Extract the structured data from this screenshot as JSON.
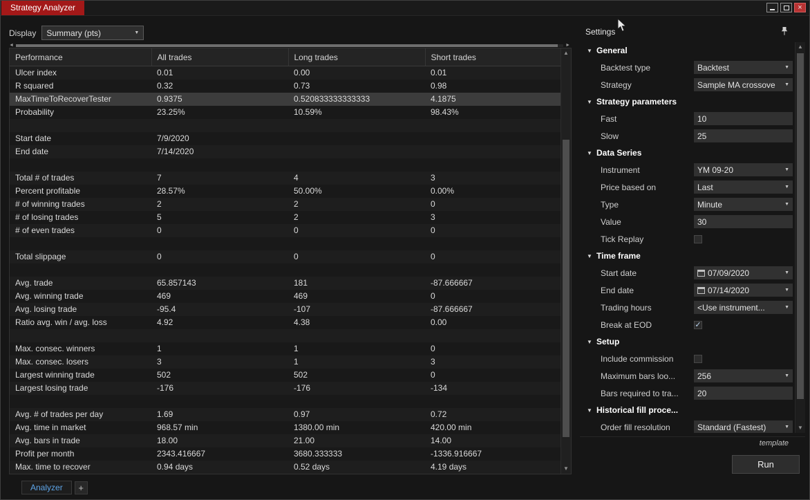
{
  "window": {
    "title": "Strategy Analyzer"
  },
  "toolbar": {
    "display_label": "Display",
    "display_value": "Summary (pts)"
  },
  "table": {
    "columns": [
      "Performance",
      "All trades",
      "Long trades",
      "Short trades"
    ],
    "selected_row": 2,
    "rows": [
      [
        "Ulcer index",
        "0.01",
        "0.00",
        "0.01"
      ],
      [
        "R squared",
        "0.32",
        "0.73",
        "0.98"
      ],
      [
        "MaxTimeToRecoverTester",
        "0.9375",
        "0.520833333333333",
        "4.1875"
      ],
      [
        "Probability",
        "23.25%",
        "10.59%",
        "98.43%"
      ],
      [
        "",
        "",
        "",
        ""
      ],
      [
        "Start date",
        "7/9/2020",
        "",
        ""
      ],
      [
        "End date",
        "7/14/2020",
        "",
        ""
      ],
      [
        "",
        "",
        "",
        ""
      ],
      [
        "Total # of trades",
        "7",
        "4",
        "3"
      ],
      [
        "Percent profitable",
        "28.57%",
        "50.00%",
        "0.00%"
      ],
      [
        "# of winning trades",
        "2",
        "2",
        "0"
      ],
      [
        "# of losing trades",
        "5",
        "2",
        "3"
      ],
      [
        "# of even trades",
        "0",
        "0",
        "0"
      ],
      [
        "",
        "",
        "",
        ""
      ],
      [
        "Total slippage",
        "0",
        "0",
        "0"
      ],
      [
        "",
        "",
        "",
        ""
      ],
      [
        "Avg. trade",
        "65.857143",
        "181",
        "-87.666667"
      ],
      [
        "Avg. winning trade",
        "469",
        "469",
        "0"
      ],
      [
        "Avg. losing trade",
        "-95.4",
        "-107",
        "-87.666667"
      ],
      [
        "Ratio avg. win / avg. loss",
        "4.92",
        "4.38",
        "0.00"
      ],
      [
        "",
        "",
        "",
        ""
      ],
      [
        "Max. consec. winners",
        "1",
        "1",
        "0"
      ],
      [
        "Max. consec. losers",
        "3",
        "1",
        "3"
      ],
      [
        "Largest winning trade",
        "502",
        "502",
        "0"
      ],
      [
        "Largest losing trade",
        "-176",
        "-176",
        "-134"
      ],
      [
        "",
        "",
        "",
        ""
      ],
      [
        "Avg. # of trades per day",
        "1.69",
        "0.97",
        "0.72"
      ],
      [
        "Avg. time in market",
        "968.57 min",
        "1380.00 min",
        "420.00 min"
      ],
      [
        "Avg. bars in trade",
        "18.00",
        "21.00",
        "14.00"
      ],
      [
        "Profit per month",
        "2343.416667",
        "3680.333333",
        "-1336.916667"
      ],
      [
        "Max. time to recover",
        "0.94 days",
        "0.52 days",
        "4.19 days"
      ]
    ]
  },
  "settings": {
    "title": "Settings",
    "sections": [
      {
        "label": "General",
        "items": [
          {
            "label": "Backtest type",
            "control": "dropdown",
            "value": "Backtest"
          },
          {
            "label": "Strategy",
            "control": "dropdown",
            "value": "Sample MA crossove"
          }
        ]
      },
      {
        "label": "Strategy parameters",
        "items": [
          {
            "label": "Fast",
            "control": "input",
            "value": "10"
          },
          {
            "label": "Slow",
            "control": "input",
            "value": "25"
          }
        ]
      },
      {
        "label": "Data Series",
        "items": [
          {
            "label": "Instrument",
            "control": "dropdown",
            "value": "YM 09-20"
          },
          {
            "label": "Price based on",
            "control": "dropdown",
            "value": "Last"
          },
          {
            "label": "Type",
            "control": "dropdown",
            "value": "Minute"
          },
          {
            "label": "Value",
            "control": "input",
            "value": "30"
          },
          {
            "label": "Tick Replay",
            "control": "checkbox",
            "checked": false
          }
        ]
      },
      {
        "label": "Time frame",
        "items": [
          {
            "label": "Start date",
            "control": "date",
            "value": "07/09/2020"
          },
          {
            "label": "End date",
            "control": "date",
            "value": "07/14/2020"
          },
          {
            "label": "Trading hours",
            "control": "dropdown",
            "value": "<Use instrument..."
          },
          {
            "label": "Break at EOD",
            "control": "checkbox",
            "checked": true
          }
        ]
      },
      {
        "label": "Setup",
        "items": [
          {
            "label": "Include commission",
            "control": "checkbox",
            "checked": false
          },
          {
            "label": "Maximum bars loo...",
            "control": "dropdown",
            "value": "256"
          },
          {
            "label": "Bars required to tra...",
            "control": "input",
            "value": "20"
          }
        ]
      },
      {
        "label": "Historical fill proce...",
        "items": [
          {
            "label": "Order fill resolution",
            "control": "dropdown",
            "value": "Standard (Fastest)"
          }
        ]
      }
    ],
    "footer": {
      "template": "template",
      "run": "Run"
    }
  },
  "tabs": {
    "analyzer": "Analyzer",
    "add": "+"
  },
  "icons": {
    "dropdown_arrow": "▼",
    "section_expanded": "▼",
    "scroll_up": "▲",
    "scroll_down": "▼",
    "scroll_left": "◄",
    "scroll_right": "►",
    "check": "✓",
    "close": "×"
  },
  "colors": {
    "title_tab_red": "#a31818",
    "close_button_red": "#b83232",
    "negative_value_red": "#d83a3a",
    "active_tab_blue": "#5ea5e8"
  }
}
